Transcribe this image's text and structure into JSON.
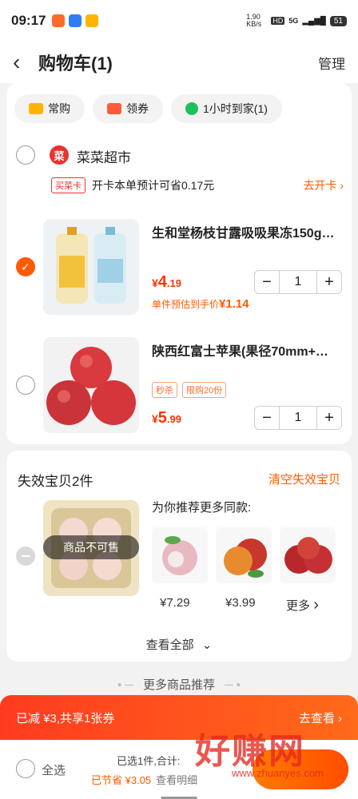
{
  "status_bar": {
    "time": "09:17",
    "net_speed": "1.90 KB/s",
    "hd": "HD",
    "signal": "5G",
    "battery": "51"
  },
  "header": {
    "title": "购物车(1)",
    "manage": "管理"
  },
  "filters": [
    {
      "label": "常购",
      "icon": "cart-icon"
    },
    {
      "label": "领券",
      "icon": "coupon-icon"
    },
    {
      "label": "1小时到家(1)",
      "icon": "bolt-icon"
    }
  ],
  "store": {
    "name": "菜菜超市",
    "logo_char": "菜"
  },
  "promo": {
    "tag": "买菜卡",
    "text": "开卡本单预计可省0.17元",
    "action": "去开卡 ›"
  },
  "items": [
    {
      "name": "生和堂杨枝甘露吸吸果冻150g…",
      "price_int": "4",
      "price_dec": ".19",
      "estimate_label": "单件预估到手价",
      "estimate_price": "¥1.14",
      "qty": "1",
      "checked": true
    },
    {
      "name": "陕西红富士苹果(果径70mm+…",
      "tags": [
        "秒杀",
        "限购20份"
      ],
      "price_int": "5",
      "price_dec": ".99",
      "qty": "1",
      "checked": false
    }
  ],
  "invalid": {
    "title": "失效宝贝2件",
    "clear": "清空失效宝贝",
    "unavailable": "商品不可售",
    "rec_title": "为你推荐更多同款:",
    "rec_prices": [
      "¥7.29",
      "¥3.99"
    ],
    "more": "更多",
    "view_all": "查看全部"
  },
  "more_recommend": "更多商品推荐",
  "coupon_bar": {
    "text": "已减 ¥3,共享1张券",
    "action": "去查看 ›"
  },
  "footer": {
    "select_all": "全选",
    "summary": "已选1件,合计:",
    "saved": "已节省 ¥3.05",
    "detail": "查看明细"
  },
  "watermark": {
    "text": "好赚网",
    "url": "www.zhuanyes.com"
  },
  "colors": {
    "accent": "#ff5a00",
    "price": "#ff3300"
  }
}
